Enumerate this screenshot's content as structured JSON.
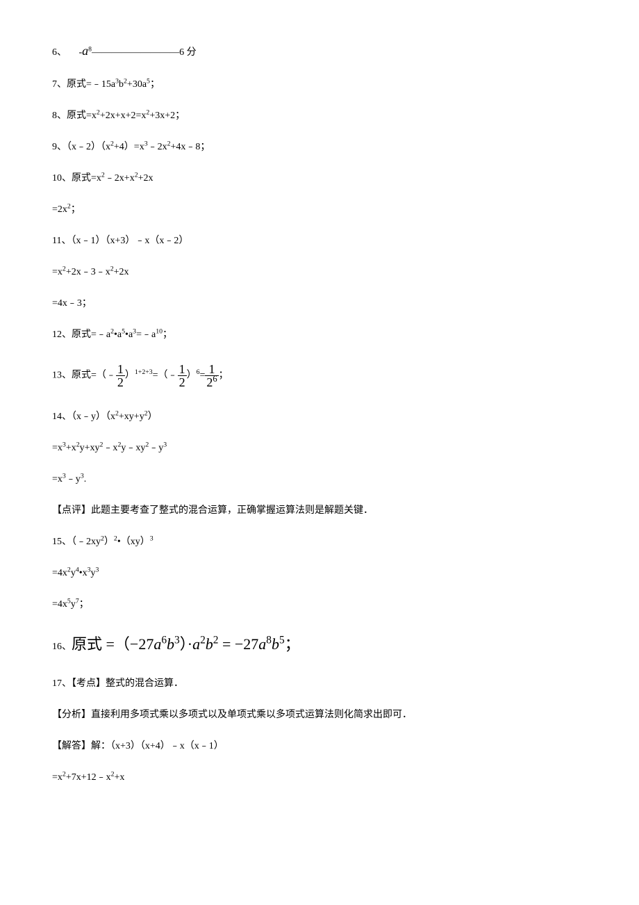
{
  "lines": {
    "l6_a": "6、 ",
    "l6_b": "-",
    "l6_c": "a",
    "l6_d": "8",
    "l6_e": "—————————6 分",
    "l7": "7、原式=﹣15a",
    "l7b": "3",
    "l7c": "b",
    "l7d": "2",
    "l7e": "+30a",
    "l7f": "5",
    "l7g": "；",
    "l8": "8、原式=x",
    "l8b": "2",
    "l8c": "+2x+x+2=x",
    "l8d": "2",
    "l8e": "+3x+2；",
    "l9": "9、（x﹣2）（x",
    "l9b": "2",
    "l9c": "+4）=x",
    "l9d": "3",
    "l9e": "﹣2x",
    "l9f": "2",
    "l9g": "+4x﹣8；",
    "l10": "10、原式=x",
    "l10b": "2",
    "l10c": "﹣2x+x",
    "l10d": "2",
    "l10e": "+2x",
    "l10r": "=2x",
    "l10r2": "2",
    "l10r3": "；",
    "l11": "11、（x﹣1）（x+3）﹣x（x﹣2）",
    "l11b": "=x",
    "l11c": "2",
    "l11d": "+2x﹣3﹣x",
    "l11e": "2",
    "l11f": "+2x",
    "l11g": "=4x﹣3；",
    "l12": "12、原式=﹣a",
    "l12b": "2",
    "l12c": "•a",
    "l12d": "5",
    "l12e": "•a",
    "l12f": "3",
    "l12g": "=﹣a",
    "l12h": "10",
    "l12i": "；",
    "l13a": "13、原式=（﹣",
    "l13b_num": "1",
    "l13b_den": "2",
    "l13c": "）",
    "l13d": "1+2+3",
    "l13e": "=（﹣",
    "l13f_num": "1",
    "l13f_den": "2",
    "l13g": "）",
    "l13h": "6",
    "l13i": "=",
    "l13j_num": "1",
    "l13j_den": "2",
    "l13j_exp": "6",
    "l13k": "；",
    "l14": "14、（x﹣y）（x",
    "l14b": "2",
    "l14c": "+xy+y",
    "l14d": "2",
    "l14e": "）",
    "l14f": "=x",
    "l14g": "3",
    "l14h": "+x",
    "l14i": "2",
    "l14j": "y+xy",
    "l14k": "2",
    "l14l": "﹣x",
    "l14m": "2",
    "l14n": "y﹣xy",
    "l14o": "2",
    "l14p": "﹣y",
    "l14q": "3",
    "l14r": "=x",
    "l14s": "3",
    "l14t": "﹣y",
    "l14u": "3",
    "l14v": ".",
    "comment1": "【点评】此题主要考查了整式的混合运算，正确掌握运算法则是解题关键．",
    "l15": "15、（﹣2xy",
    "l15b": "2",
    "l15c": "）",
    "l15d": "2",
    "l15e": "•（xy）",
    "l15f": "3",
    "l15g": "=4x",
    "l15h": "2",
    "l15i": "y",
    "l15j": "4",
    "l15k": "•x",
    "l15l": "3",
    "l15m": "y",
    "l15n": "3",
    "l15o": "=4x",
    "l15p": "5",
    "l15q": "y",
    "l15r": "7",
    "l15s": "；",
    "l16a": "16、",
    "l16b": "原式 =（−27",
    "l16c": "a",
    "l16d": "6",
    "l16e": "b",
    "l16f": "3",
    "l16g": "）·",
    "l16h": "a",
    "l16i": "2",
    "l16j": "b",
    "l16k": "2",
    "l16l": " = −27",
    "l16m": "a",
    "l16n": "8",
    "l16o": "b",
    "l16p": "5",
    "l16q": "；",
    "l17a": "17、【考点】整式的混合运算．",
    "l17b": "【分析】直接利用多项式乘以多项式以及单项式乘以多项式运算法则化简求出即可．",
    "l17c": "【解答】解：（x+3）（x+4）﹣x（x﹣1）",
    "l17d": "=x",
    "l17e": "2",
    "l17f": "+7x+12﹣x",
    "l17g": "2",
    "l17h": "+x"
  }
}
